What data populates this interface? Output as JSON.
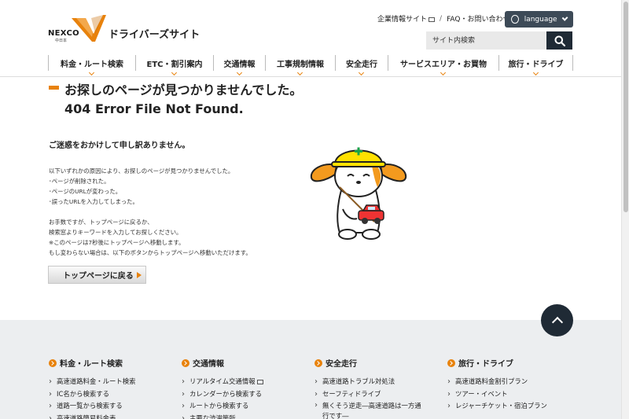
{
  "header": {
    "logo_text": "NEXCO",
    "logo_sub": "中日本",
    "site_name": "ドライバーズサイト",
    "top_links": [
      {
        "label": "企業情報サイト"
      },
      {
        "label": "FAQ・お問い合わせ"
      }
    ],
    "separator": "/",
    "language_label": "language",
    "search_placeholder": "サイト内検索"
  },
  "nav": [
    {
      "label": "料金・ルート検索"
    },
    {
      "label": "ETC・割引案内"
    },
    {
      "label": "交通情報"
    },
    {
      "label": "工事規制情報"
    },
    {
      "label": "安全走行"
    },
    {
      "label": "サービスエリア・お買物"
    },
    {
      "label": "旅行・ドライブ"
    }
  ],
  "main": {
    "title": "お探しのページが見つかりませんでした。",
    "subtitle": "404 Error File Not Found.",
    "apology": "ご迷惑をおかけして申し訳ありません。",
    "reasons": [
      "以下いずれかの原因により、お探しのページが見つかりませんでした。",
      "･ページが削除された。",
      "･ページのURLが変わった。",
      "･誤ったURLを入力してしまった。"
    ],
    "instructions": [
      "お手数ですが、トップページに戻るか、",
      "検索窓よりキーワードを入力してお探しください。",
      "※このページは7秒後にトップページへ移動します。",
      "もし変わらない場合は、以下のボタンからトップページへ移動いただけます。"
    ],
    "top_button": "トップページに戻る"
  },
  "footer": {
    "columns": [
      {
        "heading": "料金・ルート検索",
        "links": [
          "高速道路料金・ルート検索",
          "IC名から検索する",
          "道路一覧から検索する",
          "高速道路簡易料金表"
        ]
      },
      {
        "heading": "交通情報",
        "links": [
          "リアルタイム交通情報",
          "カレンダーから検索する",
          "ルートから検索する",
          "主要な渋滞箇所"
        ]
      },
      {
        "heading": "安全走行",
        "links": [
          "高速道路トラブル対処法",
          "セーフティドライブ",
          "無くそう逆走―高速道路は一方通行です―"
        ]
      },
      {
        "heading": "旅行・ドライブ",
        "links": [
          "高速道路料金割引プラン",
          "ツアー・イベント",
          "レジャーチケット・宿泊プラン"
        ]
      }
    ]
  },
  "colors": {
    "accent": "#e8820c",
    "dark": "#1f2a35",
    "footer_bg": "#eceef0"
  }
}
